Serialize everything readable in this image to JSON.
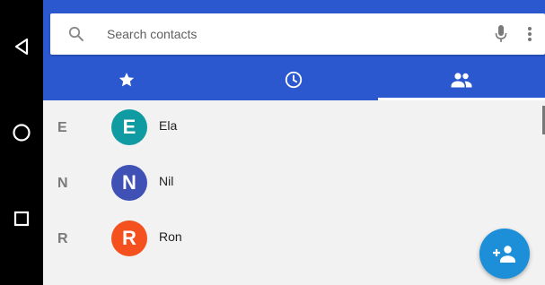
{
  "navbar": {
    "back_icon": "back-triangle-icon",
    "home_icon": "home-circle-icon",
    "recents_icon": "recents-square-icon"
  },
  "search": {
    "placeholder": "Search contacts",
    "value": ""
  },
  "tabs": [
    {
      "id": "favorites",
      "icon": "star-icon",
      "active": false
    },
    {
      "id": "recents",
      "icon": "clock-icon",
      "active": false
    },
    {
      "id": "contacts",
      "icon": "people-icon",
      "active": true
    }
  ],
  "contacts": [
    {
      "section": "E",
      "initial": "E",
      "name": "Ela",
      "color": "#109aa1"
    },
    {
      "section": "N",
      "initial": "N",
      "name": "Nil",
      "color": "#3f51b5"
    },
    {
      "section": "R",
      "initial": "R",
      "name": "Ron",
      "color": "#f4511e"
    }
  ],
  "fab": {
    "icon": "add-contact-icon"
  },
  "colors": {
    "header": "#2b57cf",
    "fab": "#1c8fd8",
    "background": "#f2f2f2"
  }
}
